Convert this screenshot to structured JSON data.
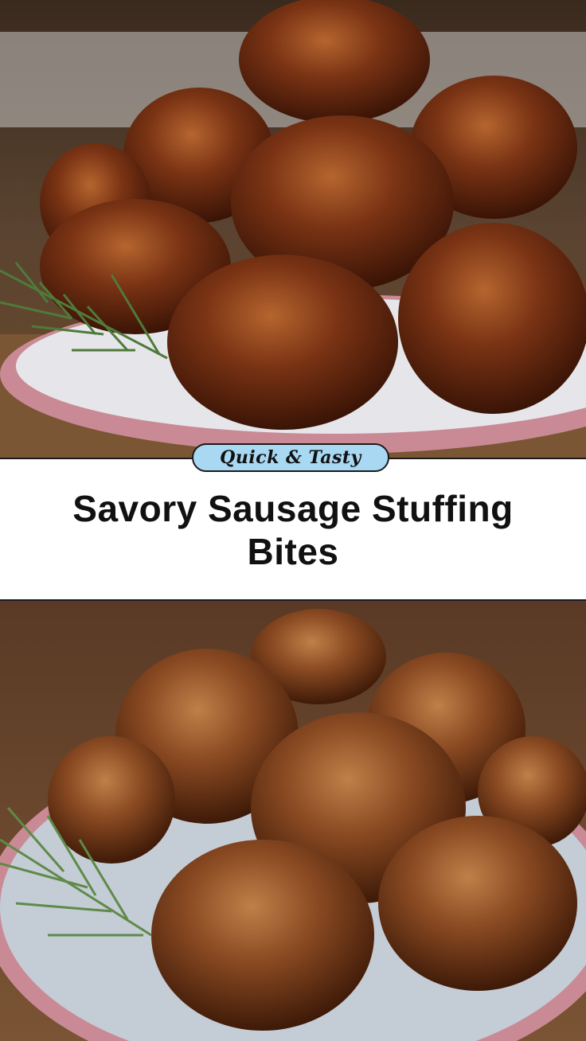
{
  "badge": {
    "text": "Quick & Tasty",
    "color": "#a9d8f2"
  },
  "title": {
    "line1": "Savory Sausage Stuffing",
    "line2": "Bites"
  },
  "photos": {
    "top": {
      "subject": "meatball-plate-photo",
      "plate_rim_color": "#c98a95"
    },
    "bottom": {
      "subject": "meatball-plate-photo",
      "plate_rim_color": "#c98a95"
    }
  }
}
